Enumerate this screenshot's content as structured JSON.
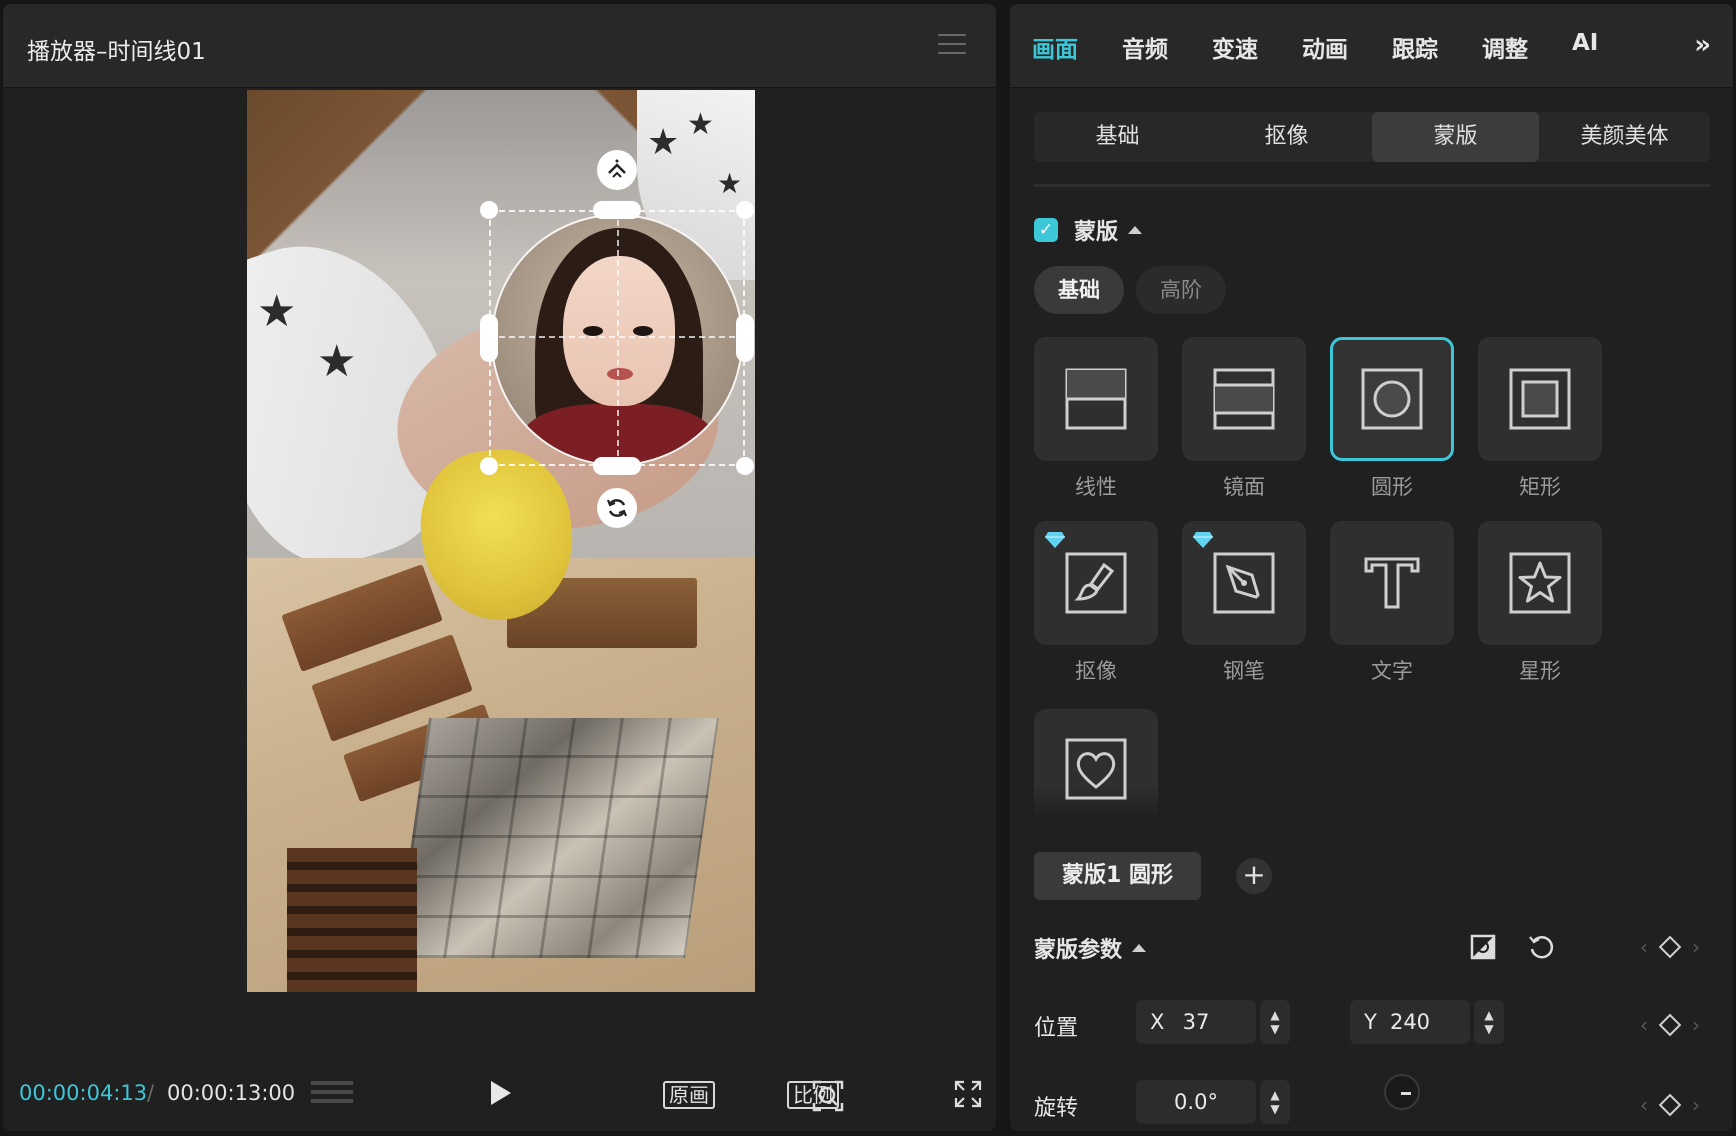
{
  "player": {
    "title": "播放器–时间线01",
    "current_time": "00:00:04:13",
    "separator": "/",
    "total_time": "00:00:13:00",
    "btn_original": "原画",
    "btn_ratio": "比例"
  },
  "inspector": {
    "tabs": [
      "画面",
      "音频",
      "变速",
      "动画",
      "跟踪",
      "调整",
      "AI"
    ],
    "active_tab": "画面",
    "subtabs": [
      "基础",
      "抠像",
      "蒙版",
      "美颜美体"
    ],
    "active_subtab": "蒙版",
    "mask_section_label": "蒙版",
    "mask_enabled": true,
    "mode_pills": [
      "基础",
      "高阶"
    ],
    "shapes": [
      {
        "label": "线性",
        "icon": "linear-mask-icon",
        "premium": false
      },
      {
        "label": "镜面",
        "icon": "mirror-mask-icon",
        "premium": false
      },
      {
        "label": "圆形",
        "icon": "circle-mask-icon",
        "premium": false,
        "selected": true
      },
      {
        "label": "矩形",
        "icon": "rectangle-mask-icon",
        "premium": false
      },
      {
        "label": "抠像",
        "icon": "brush-mask-icon",
        "premium": true
      },
      {
        "label": "钢笔",
        "icon": "pen-mask-icon",
        "premium": true
      },
      {
        "label": "文字",
        "icon": "text-mask-icon",
        "premium": false
      },
      {
        "label": "星形",
        "icon": "star-mask-icon",
        "premium": false
      }
    ],
    "extra_shape_icon": "heart-mask-icon",
    "mask_chip": "蒙版1 圆形",
    "params_title": "蒙版参数",
    "position_label": "位置",
    "pos_x_axis": "X",
    "pos_x": "37",
    "pos_y_axis": "Y",
    "pos_y": "240",
    "rotation_label": "旋转",
    "rotation": "0.0°"
  },
  "colors": {
    "accent": "#3cc7d8",
    "panel": "#202020",
    "header": "#282828"
  }
}
